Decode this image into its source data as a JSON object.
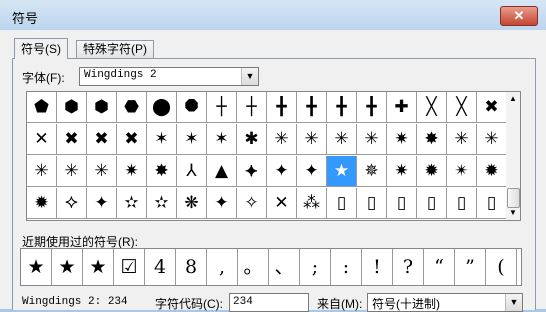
{
  "window": {
    "title": "符号",
    "close": "✕"
  },
  "tabs": [
    "符号(S)",
    "特殊字符(P)"
  ],
  "font": {
    "label": "字体(F):",
    "value": "Wingdings 2"
  },
  "symbols": [
    "⬟",
    "⬢",
    "⬢",
    "⬣",
    "⬤",
    "⯃",
    "┼",
    "┼",
    "╋",
    "╋",
    "╋",
    "╋",
    "✚",
    "╳",
    "╳",
    "✖",
    "✕",
    "✖",
    "✖",
    "✖",
    "✶",
    "✶",
    "✶",
    "✱",
    "✳",
    "✳",
    "✳",
    "✳",
    "✷",
    "✸",
    "✳",
    "✳",
    "✳",
    "✳",
    "✳",
    "✷",
    "✸",
    "⅄",
    "▲",
    "⯌",
    "✦",
    "✦",
    "★",
    "✵",
    "✷",
    "✹",
    "✴",
    "✹",
    "✹",
    "⯎",
    "✦",
    "✫",
    "✫",
    "❋",
    "✦",
    "✧",
    "✕",
    "⁂",
    "▯",
    "▯",
    "▯",
    "▯",
    "▯",
    "▯"
  ],
  "selected_index": 42,
  "recent": {
    "label": "近期使用过的符号(R):",
    "items": [
      "★",
      "★",
      "★",
      "☑",
      "4",
      "8",
      ",",
      "。",
      "、",
      ";",
      ":",
      "!",
      "?",
      "“",
      "”",
      "("
    ]
  },
  "footer": {
    "code_name": "Wingdings 2: 234",
    "char_code_label": "字符代码(C):",
    "char_code": "234",
    "from_label": "来自(M):",
    "from_value": "符号(十进制)"
  }
}
